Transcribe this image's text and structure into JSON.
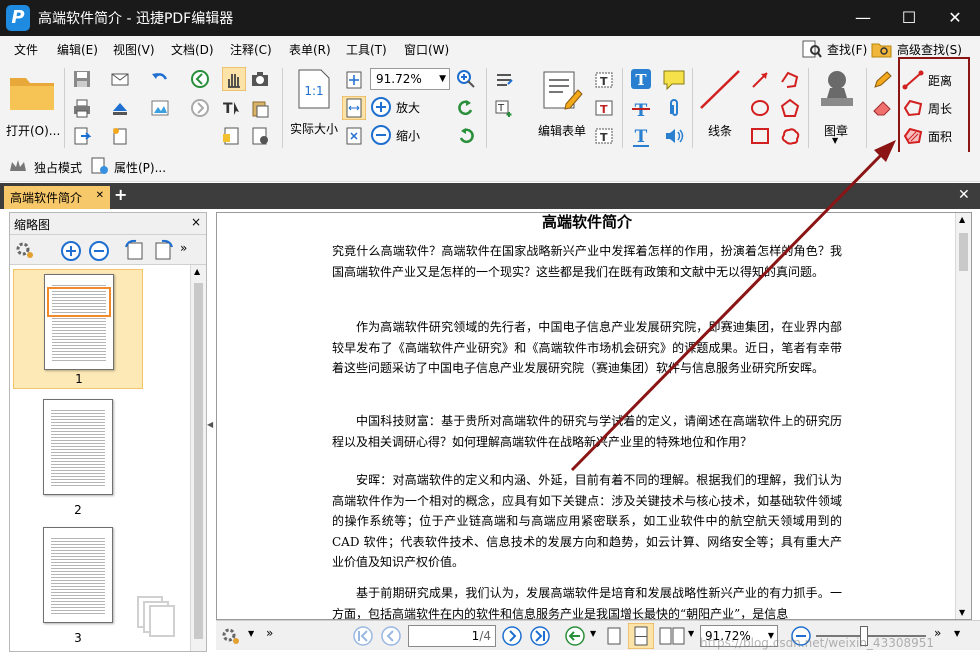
{
  "window": {
    "title": "高端软件简介 - 迅捷PDF编辑器",
    "logo_letter": "P",
    "minimize": "—",
    "maximize": "☐",
    "close": "✕"
  },
  "menu": {
    "items": [
      "文件",
      "编辑(E)",
      "视图(V)",
      "文档(D)",
      "注释(C)",
      "表单(R)",
      "工具(T)",
      "窗口(W)"
    ],
    "find": "查找(F)",
    "advanced_find": "高级查找(S)"
  },
  "ribbon": {
    "open": "打开(O)...",
    "zoom_value": "91.72%",
    "enlarge": "放大",
    "shrink": "缩小",
    "actual_size": "实际大小",
    "actual_size_icon_text": "1:1",
    "edit_form": "编辑表单",
    "lines": "线条",
    "stamp": "图章",
    "distance": "距离",
    "perimeter": "周长",
    "area": "面积"
  },
  "modebar": {
    "exclusive_mode": "独占模式",
    "properties": "属性(P)..."
  },
  "tabs": {
    "doc_tab": "高端软件简介",
    "tab_close": "✕",
    "add_tab": "+",
    "close_all": "✕"
  },
  "thumbnails": {
    "title": "缩略图",
    "close": "×",
    "pages": [
      "1",
      "2",
      "3"
    ]
  },
  "document": {
    "title": "高端软件简介",
    "paragraphs": [
      "究竟什么高端软件？高端软件在国家战略新兴产业中发挥着怎样的作用，扮演着怎样的角色？我国高端软件产业又是怎样的一个现实？这些都是我们在既有政策和文献中无以得知的真问题。",
      "作为高端软件研究领域的先行者，中国电子信息产业发展研究院，即赛迪集团，在业界内部较早发布了《高端软件产业研究》和《高端软件市场机会研究》的课题成果。近日，笔者有幸带着这些问题采访了中国电子信息产业发展研究院（赛迪集团）软件与信息服务业研究所安晖。",
      "中国科技财富：基于贵所对高端软件的研究与学试着的定义，请阐述在高端软件上的研究历程以及相关调研心得？如何理解高端软件在战略新兴产业里的特殊地位和作用？",
      "安晖：对高端软件的定义和内涵、外延，目前有着不同的理解。根据我们的理解，我们认为高端软件作为一个相对的概念，应具有如下关键点：涉及关键技术与核心技术，如基础软件领域的操作系统等；位于产业链高端和与高端应用紧密联系，如工业软件中的航空航天领域用到的 CAD 软件；代表软件技术、信息技术的发展方向和趋势，如云计算、网络安全等；具有重大产业价值及知识产权价值。",
      "基于前期研究成果，我们认为，发展高端软件是培育和发展战略性新兴产业的有力抓手。一方面，包括高端软件在内的软件和信息服务产业是我国增长最快的“朝阳产业”，是信息"
    ]
  },
  "statusbar": {
    "page_current": "1",
    "page_total": "/4",
    "zoom": "91.72%"
  },
  "watermark": "https://blog.csdn.net/weixin_43308951",
  "colors": {
    "title_bar": "#1a1a1a",
    "active_tab": "#f7c86a",
    "highlight": "#8b1414",
    "accent_blue": "#1f8be0"
  }
}
